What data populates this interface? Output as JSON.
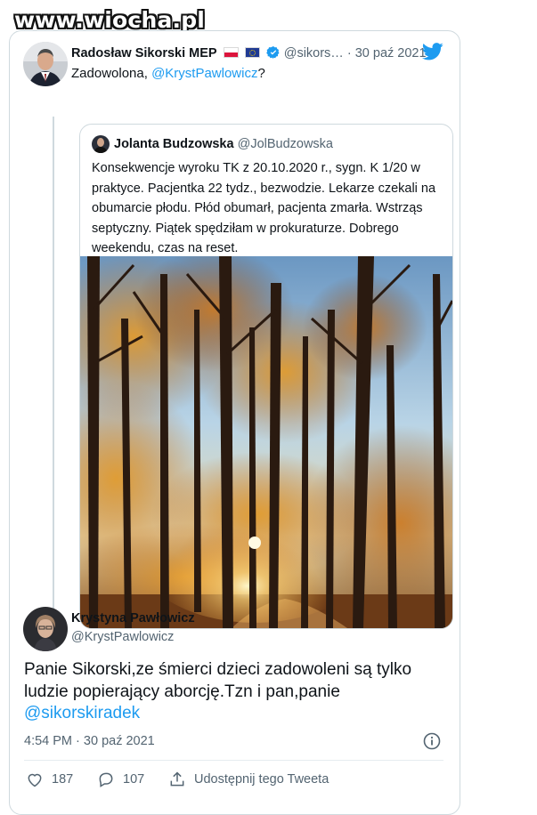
{
  "watermark": "www.wiocha.pl",
  "tweet": {
    "author_name": "Radosław Sikorski MEP",
    "handle": "@sikors…",
    "separator": "·",
    "date": "30 paź 2021",
    "text_prefix": "Zadowolona, ",
    "mention": "@KrystPawlowicz",
    "text_suffix": "?",
    "flags": [
      "flag-pl",
      "flag-eu"
    ],
    "icons": [
      "verified-icon",
      "twitter-bird-icon"
    ]
  },
  "quoted": {
    "author_name": "Jolanta Budzowska",
    "handle": "@JolBudzowska",
    "text": "Konsekwencje wyroku TK z 20.10.2020 r., sygn. K 1/20 w praktyce. Pacjentka 22 tydz., bezwodzie. Lekarze czekali na obumarcie płodu. Płód obumarł, pacjenta zmarła. Wstrząs septyczny. Piątek spędziłam w prokuraturze. Dobrego weekendu, czas na reset.",
    "image": "autumn-forest-photo"
  },
  "reply": {
    "author_name": "Krystyna Pawłowicz",
    "handle": "@KrystPawlowicz",
    "text": "Panie Sikorski,ze śmierci dzieci zadowoleni są tylko ludzie popierający aborcję.Tzn i pan,panie ",
    "mention": "@sikorskiradek",
    "time": "4:54 PM",
    "separator": "·",
    "date": "30 paź 2021",
    "info_icon": "info-icon"
  },
  "actions": {
    "like_count": "187",
    "reply_count": "107",
    "share_label": "Udostępnij tego Tweeta"
  },
  "colors": {
    "accent": "#1d9bf0",
    "secondary_text": "#536471",
    "border": "#cfd9de"
  }
}
